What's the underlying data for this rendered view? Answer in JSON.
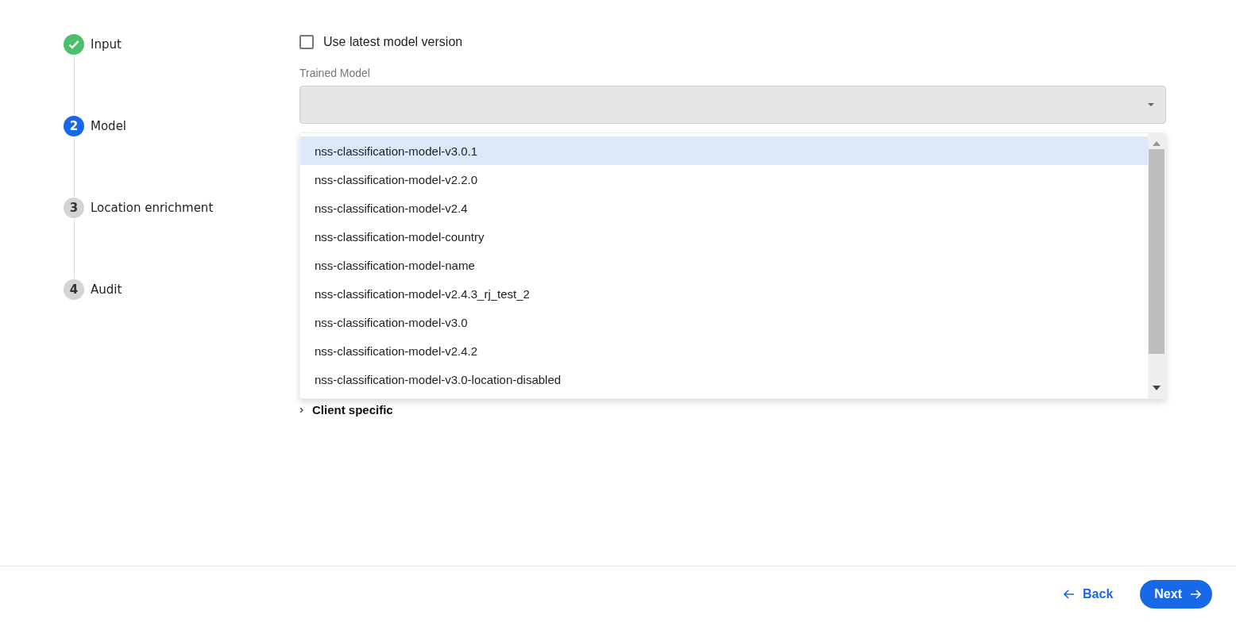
{
  "stepper": {
    "steps": [
      {
        "label": "Input",
        "completed": true,
        "selected": false
      },
      {
        "number": "2",
        "label": "Model",
        "completed": false,
        "selected": true
      },
      {
        "number": "3",
        "label": "Location enrichment",
        "completed": false,
        "selected": false
      },
      {
        "number": "4",
        "label": "Audit",
        "completed": false,
        "selected": false
      }
    ]
  },
  "latest_version": {
    "label": "Use latest model version",
    "checked": false
  },
  "trained_model": {
    "label": "Trained Model",
    "disabled": true,
    "options": [
      {
        "label": "nss-classification-model-v3.0.1",
        "selected": true
      },
      {
        "label": "nss-classification-model-v2.2.0",
        "selected": false
      },
      {
        "label": "nss-classification-model-v2.4",
        "selected": false
      },
      {
        "label": "nss-classification-model-country",
        "selected": false
      },
      {
        "label": "nss-classification-model-name",
        "selected": false
      },
      {
        "label": "nss-classification-model-v2.4.3_rj_test_2",
        "selected": false
      },
      {
        "label": "nss-classification-model-v3.0",
        "selected": false
      },
      {
        "label": "nss-classification-model-v2.4.2",
        "selected": false
      },
      {
        "label": "nss-classification-model-v3.0-location-disabled",
        "selected": false
      }
    ]
  },
  "section": {
    "label": "Client specific",
    "expanded": false
  },
  "footer": {
    "back": "Back",
    "next": "Next"
  }
}
